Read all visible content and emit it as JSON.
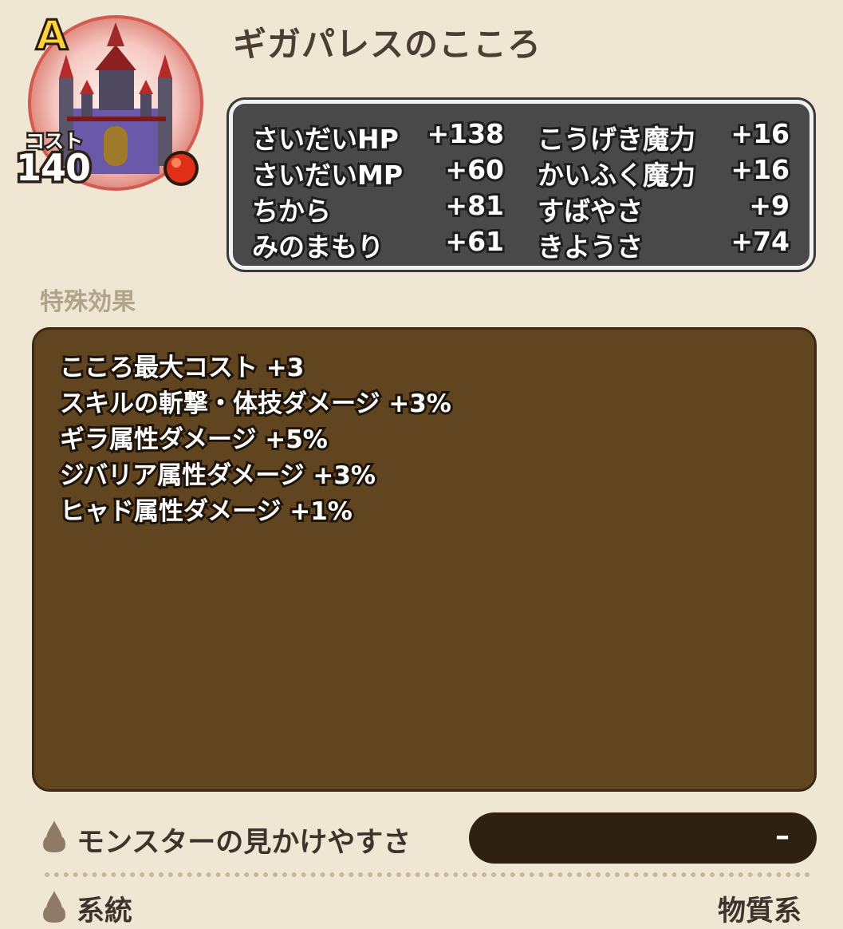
{
  "header": {
    "rank": "A",
    "cost_label": "コスト",
    "cost_value": "140",
    "title": "ギガパレスのこころ",
    "portrait_icon": "castle-emblem-icon",
    "color_orb_icon": "red-orb-icon"
  },
  "stats": {
    "left": [
      {
        "label": "さいだいHP",
        "value": "+138"
      },
      {
        "label": "さいだいMP",
        "value": "+60"
      },
      {
        "label": "ちから",
        "value": "+81"
      },
      {
        "label": "みのまもり",
        "value": "+61"
      }
    ],
    "right": [
      {
        "label": "こうげき魔力",
        "value": "+16"
      },
      {
        "label": "かいふく魔力",
        "value": "+16"
      },
      {
        "label": "すばやさ",
        "value": "+9"
      },
      {
        "label": "きようさ",
        "value": "+74"
      }
    ]
  },
  "effects": {
    "section_label": "特殊効果",
    "items": [
      "こころ最大コスト +3",
      "スキルの斬撃・体技ダメージ +3%",
      "ギラ属性ダメージ +5%",
      "ジバリア属性ダメージ +3%",
      "ヒャド属性ダメージ +1%"
    ]
  },
  "info": {
    "visibility_label": "モンスターの見かけやすさ",
    "visibility_value": "–",
    "type_label": "系統",
    "type_value": "物質系",
    "bullet_icon": "drop-icon"
  },
  "colors": {
    "background": "#efe6d3",
    "stats_panel": "#494949",
    "effects_panel": "#614420",
    "rank_gold": "#ffd23a",
    "orb_red": "#e0301a"
  }
}
